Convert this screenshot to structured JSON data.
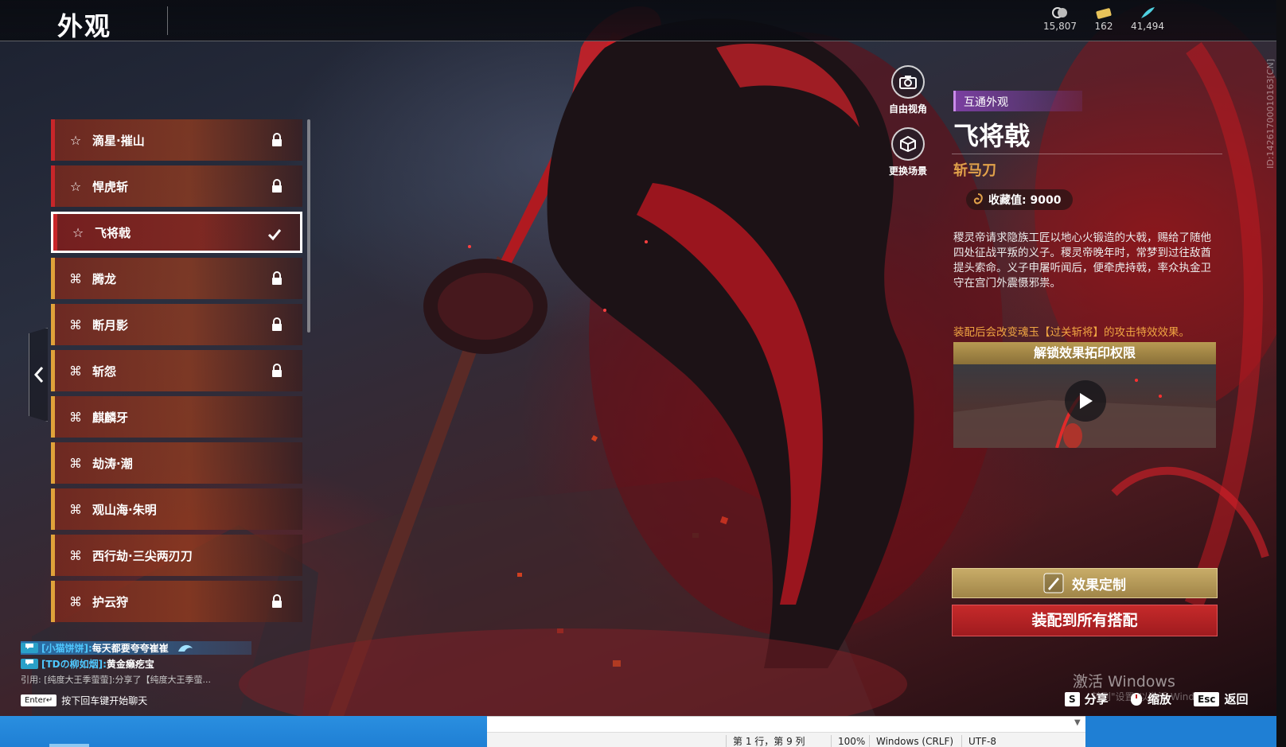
{
  "header": {
    "title": "外观",
    "currencies": [
      {
        "icon": "spirit-coin-icon",
        "value": "15,807"
      },
      {
        "icon": "ticket-icon",
        "value": "162"
      },
      {
        "icon": "feather-icon",
        "value": "41,494"
      }
    ]
  },
  "list": {
    "items": [
      {
        "name": "滴星·摧山",
        "rarity": "red",
        "icon": "star-outline-icon",
        "locked": true,
        "selected": false
      },
      {
        "name": "悍虎斩",
        "rarity": "red",
        "icon": "star-outline-icon",
        "locked": true,
        "selected": false
      },
      {
        "name": "飞将戟",
        "rarity": "red",
        "icon": "star-outline-icon",
        "locked": false,
        "selected": true
      },
      {
        "name": "腾龙",
        "rarity": "gold",
        "icon": "cross-pattern-icon",
        "locked": true,
        "selected": false
      },
      {
        "name": "断月影",
        "rarity": "gold",
        "icon": "cross-pattern-icon",
        "locked": true,
        "selected": false
      },
      {
        "name": "斩怨",
        "rarity": "gold",
        "icon": "cross-pattern-icon",
        "locked": true,
        "selected": false
      },
      {
        "name": "麒麟牙",
        "rarity": "gold",
        "icon": "cross-pattern-icon",
        "locked": false,
        "selected": false
      },
      {
        "name": "劫涛·潮",
        "rarity": "gold",
        "icon": "cross-pattern-icon",
        "locked": false,
        "selected": false
      },
      {
        "name": "观山海·朱明",
        "rarity": "gold",
        "icon": "cross-pattern-icon",
        "locked": false,
        "selected": false
      },
      {
        "name": "西行劫·三尖两刃刀",
        "rarity": "gold",
        "icon": "cross-pattern-icon",
        "locked": false,
        "selected": false
      },
      {
        "name": "护云狩",
        "rarity": "gold",
        "icon": "cross-pattern-icon",
        "locked": true,
        "selected": false
      }
    ]
  },
  "camera": {
    "free_view": "自由视角",
    "change_scene": "更换场景"
  },
  "detail": {
    "tag": "互通外观",
    "title": "飞将戟",
    "type": "斩马刀",
    "collect_label": "收藏值: 9000",
    "description": "稷灵帝请求隐族工匠以地心火锻造的大戟，赐给了随他四处征战平叛的义子。稷灵帝晚年时，常梦到过往敌酋提头索命。义子申屠听闻后，便牵虎持戟，率众执金卫守在宫门外震慑邪祟。",
    "effect_note": "装配后会改变魂玉【过关斩将】的攻击特效效果。",
    "unlock_label": "解锁效果拓印权限",
    "effect_button": "效果定制",
    "equip_button": "装配到所有搭配",
    "side_id": "ID:14261700010163[CN]"
  },
  "chat": {
    "lines": [
      {
        "name": "[小猫饼饼]:",
        "text": "每天都要夸夸崔崔",
        "highlight": true
      },
      {
        "name": "[TDの柳如烟]:",
        "text": "黄金癞疙宝",
        "highlight": false
      }
    ],
    "quote": "引用: [纯度大王季萤萤]:分享了【纯度大王季萤...",
    "enter_key": "Enter↵",
    "hint": "按下回车键开始聊天"
  },
  "hints": {
    "share_key": "S",
    "share": "分享",
    "zoom": "缩放",
    "esc_key": "Esc",
    "back": "返回"
  },
  "watermark": {
    "title": "激活 Windows",
    "sub": "转到\"设置\"以激活 Windows。"
  },
  "editor_status": {
    "position": "第 1 行，第 9 列",
    "zoom": "100%",
    "line_ending": "Windows (CRLF)",
    "encoding": "UTF-8"
  }
}
